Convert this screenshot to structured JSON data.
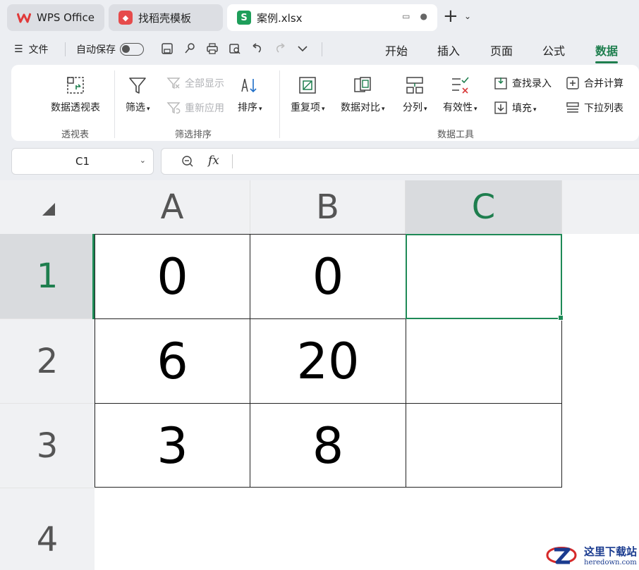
{
  "tabs": [
    {
      "label": "WPS Office"
    },
    {
      "label": "找稻壳模板"
    },
    {
      "label": "案例.xlsx"
    }
  ],
  "menu": {
    "file_label": "文件",
    "autosave_label": "自动保存",
    "autosave_on": false
  },
  "ribbon_tabs": [
    "开始",
    "插入",
    "页面",
    "公式",
    "数据"
  ],
  "active_ribbon_tab": "数据",
  "ribbon": {
    "pivot": {
      "label": "数据透视表",
      "group": "透视表"
    },
    "filter": {
      "label": "筛选",
      "show_all": "全部显示",
      "reapply": "重新应用",
      "sort": "排序",
      "group": "筛选排序"
    },
    "tools": {
      "duplicate": "重复项",
      "compare": "数据对比",
      "split": "分列",
      "validity": "有效性",
      "lookup": "查找录入",
      "fill": "填充",
      "consolidate": "合并计算",
      "dropdown": "下拉列表",
      "group": "数据工具"
    }
  },
  "formula_bar": {
    "name_box": "C1",
    "fx": "fx",
    "formula": ""
  },
  "columns": [
    "A",
    "B",
    "C"
  ],
  "selected_column": "C",
  "rows": [
    {
      "num": "1",
      "cells": [
        "0",
        "0",
        ""
      ]
    },
    {
      "num": "2",
      "cells": [
        "6",
        "20",
        ""
      ]
    },
    {
      "num": "3",
      "cells": [
        "3",
        "8",
        ""
      ]
    },
    {
      "num": "4",
      "cells": [
        "",
        "",
        ""
      ]
    }
  ],
  "selected_cell": "C1",
  "watermark": {
    "name": "这里下载站",
    "url": "heredown.com"
  },
  "colors": {
    "accent": "#1e7e4e",
    "selection": "#1e8a56"
  }
}
